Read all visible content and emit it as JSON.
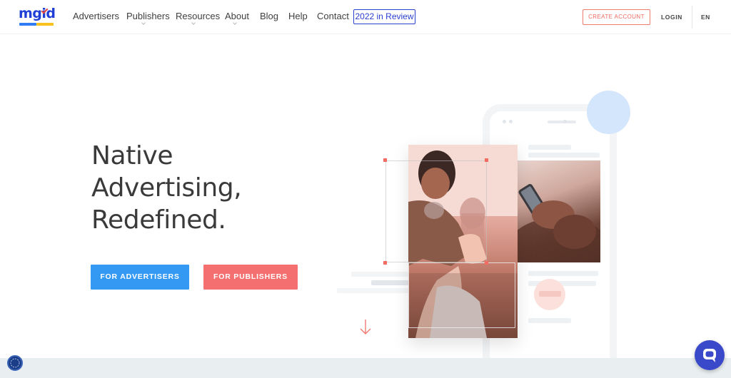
{
  "header": {
    "logo_text": "mgid",
    "nav": [
      {
        "label": "Advertisers",
        "has_dropdown": false
      },
      {
        "label": "Publishers",
        "has_dropdown": true
      },
      {
        "label": "Resources",
        "has_dropdown": true
      },
      {
        "label": "About",
        "has_dropdown": true
      },
      {
        "label": "Blog",
        "has_dropdown": false
      },
      {
        "label": "Help",
        "has_dropdown": false
      },
      {
        "label": "Contact",
        "has_dropdown": false
      }
    ],
    "review_label": "2022 in Review",
    "create_account_label": "CREATE ACCOUNT",
    "login_label": "LOGIN",
    "language_label": "EN"
  },
  "hero": {
    "title_lines": [
      "Native",
      "Advertising,",
      "Redefined."
    ],
    "advertisers_button": "FOR ADVERTISERS",
    "publishers_button": "FOR PUBLISHERS"
  },
  "icons": {
    "scroll": "arrow-down-icon",
    "chat": "chat-bubble-icon",
    "badge": "accessibility-icon"
  },
  "colors": {
    "brand_blue": "#1f3fd6",
    "button_blue": "#3399f3",
    "button_coral": "#f46f6f",
    "accent_coral": "#f06a60"
  }
}
